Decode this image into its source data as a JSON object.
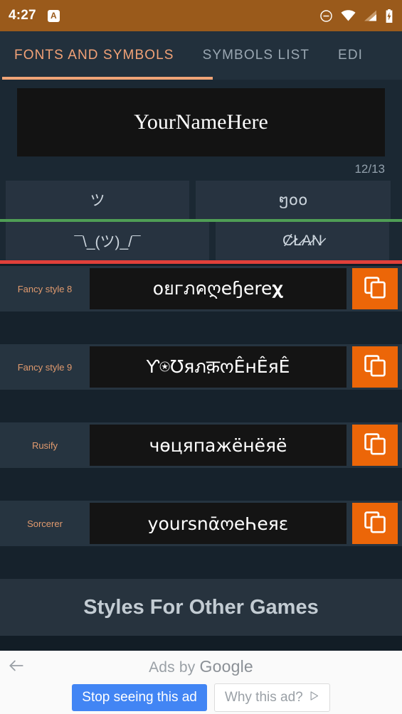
{
  "status_bar": {
    "time": "4:27",
    "app_badge_letter": "A",
    "icons": [
      "do-not-disturb-icon",
      "wifi-icon",
      "cell-signal-icon",
      "battery-charging-icon"
    ]
  },
  "tabs": [
    {
      "label": "FONTS AND SYMBOLS",
      "active": true
    },
    {
      "label": "SYMBOLS LIST",
      "active": false
    },
    {
      "label": "EDI",
      "active": false
    }
  ],
  "name_input": {
    "value": "YourNameHere",
    "placeholder": "YourNameHere",
    "counter": "12/13"
  },
  "symbol_tiles": [
    {
      "glyph": "ツ"
    },
    {
      "glyph": "ໆ໐໐"
    },
    {
      "glyph": "¯\\_(ツ)_/¯"
    },
    {
      "glyph": "Ȼ̷Ł̷A̷N̷"
    }
  ],
  "style_rows": [
    {
      "label": "Fancy style 8",
      "value": "οยгภคღeɧere𝛘",
      "copy": "copy-icon"
    },
    {
      "label": "Fancy style 9",
      "value": "Ƴ⍟Ʊяภक़ოÊнÊяÊ",
      "copy": "copy-icon"
    },
    {
      "label": "Rusify",
      "value": "чөцяпажёнёяё",
      "copy": "copy-icon"
    },
    {
      "label": "Sorcerer",
      "value": "yoursnᾱოeҺeяɛ",
      "copy": "copy-icon"
    }
  ],
  "other_games": {
    "title": "Styles For Other Games"
  },
  "ad": {
    "back_icon": "back-arrow-icon",
    "attribution_prefix": "Ads by ",
    "attribution_brand": "Google",
    "stop_label": "Stop seeing this ad",
    "why_label": "Why this ad?",
    "why_icon": "play-triangle-icon"
  },
  "colors": {
    "status_bar": "#9a5a1b",
    "accent_orange": "#ec6608",
    "tab_active": "#f2a277",
    "divider_green": "#4f9e55",
    "divider_red": "#e0403a",
    "page_bg": "#1b2833",
    "ad_blue": "#4285f4"
  }
}
